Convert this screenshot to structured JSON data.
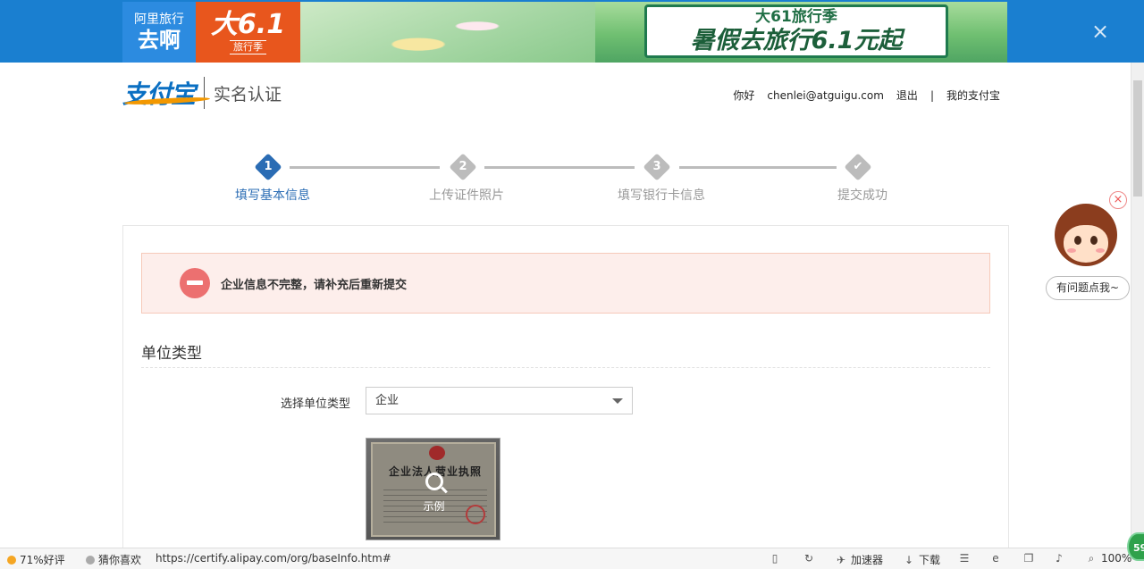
{
  "ad": {
    "brand_line1": "阿里旅行",
    "brand_line2": "去啊",
    "promo_big": "大6.1",
    "promo_small": "旅行季",
    "board_line1": "大61旅行季",
    "board_line2": "暑假去旅行6.1元起",
    "close_icon": "close-icon"
  },
  "header": {
    "logo_text": "支付宝",
    "subtitle": "实名认证",
    "nav": {
      "greeting": "你好",
      "email": "chenlei@atguigu.com",
      "logout": "退出",
      "separator": "|",
      "my_alipay": "我的支付宝"
    }
  },
  "steps": [
    {
      "number": "1",
      "label": "填写基本信息",
      "state": "active"
    },
    {
      "number": "2",
      "label": "上传证件照片",
      "state": "inactive"
    },
    {
      "number": "3",
      "label": "填写银行卡信息",
      "state": "inactive"
    },
    {
      "number": "✔",
      "label": "提交成功",
      "state": "inactive"
    }
  ],
  "colors": {
    "active_step": "#2a6cb4",
    "inactive_step": "#bcbcbc",
    "active_label": "#2a6cb4",
    "inactive_label": "#999999",
    "alert_bg": "#fdeeeb",
    "alert_icon": "#ec7070"
  },
  "form": {
    "alert_text": "企业信息不完整，请补充后重新提交",
    "section_title": "单位类型",
    "field_label": "选择单位类型",
    "select_value": "企业",
    "sample_cert_title": "企业法人营业执照",
    "sample_label": "示例"
  },
  "helper": {
    "bubble_text": "有问题点我~"
  },
  "statusbar": {
    "rating": "71%好评",
    "guess": "猜你喜欢",
    "url": "https://certify.alipay.com/org/baseInfo.htm#",
    "accelerator": "加速器",
    "download": "下载",
    "zoom": "100%",
    "badge": "59"
  }
}
